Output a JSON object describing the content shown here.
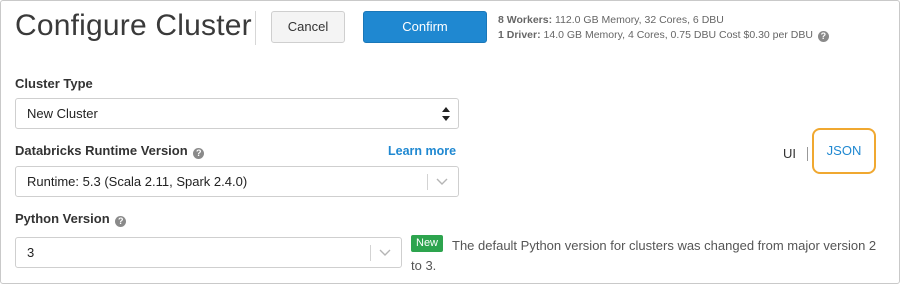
{
  "header": {
    "title": "Configure Cluster",
    "cancel_label": "Cancel",
    "confirm_label": "Confirm",
    "workers_label": "8 Workers:",
    "workers_detail": "112.0 GB Memory, 32 Cores, 6 DBU",
    "driver_label": "1 Driver:",
    "driver_detail": "14.0 GB Memory, 4 Cores, 0.75 DBU Cost $0.30 per DBU"
  },
  "cluster_type": {
    "label": "Cluster Type",
    "value": "New Cluster"
  },
  "runtime": {
    "label": "Databricks Runtime Version",
    "learn_more": "Learn more",
    "value": "Runtime: 5.3 (Scala 2.11, Spark 2.4.0)"
  },
  "python": {
    "label": "Python Version",
    "value": "3",
    "badge": "New",
    "notice": "The default Python version for clusters was changed from major version 2 to 3."
  },
  "view_toggle": {
    "ui_label": "UI",
    "json_label": "JSON"
  },
  "colors": {
    "accent": "#1f88d1",
    "highlight": "#f0a830",
    "badge": "#2da44e"
  }
}
